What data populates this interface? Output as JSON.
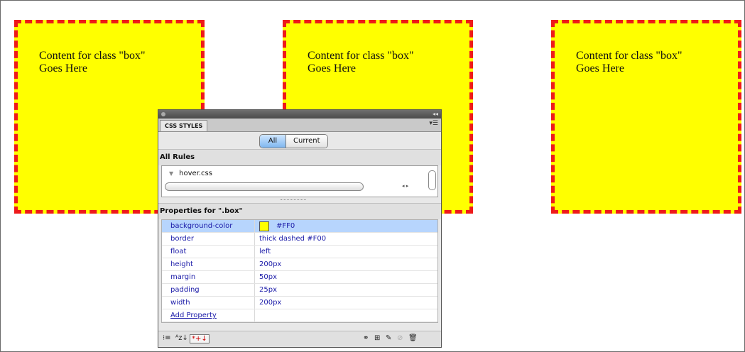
{
  "boxes": [
    {
      "line1": "Content for class \"box\"",
      "line2": "Goes Here"
    },
    {
      "line1": "Content for class \"box\"",
      "line2": "Goes Here"
    },
    {
      "line1": "Content for class \"box\"",
      "line2": "Goes Here"
    }
  ],
  "colors": {
    "box_bg": "#FFFF00",
    "box_border": "#FF0000",
    "selected_row": "#B7D5FD"
  },
  "panel": {
    "tab_label": "CSS STYLES",
    "segments": {
      "all": "All",
      "current": "Current",
      "selected": "All"
    },
    "all_rules_heading": "All Rules",
    "rules": [
      "hover.css"
    ],
    "properties_heading": "Properties for \".box\"",
    "properties": [
      {
        "name": "background-color",
        "value": "#FF0"
      },
      {
        "name": "border",
        "value": "thick dashed #F00"
      },
      {
        "name": "float",
        "value": "left"
      },
      {
        "name": "height",
        "value": "200px"
      },
      {
        "name": "margin",
        "value": "50px"
      },
      {
        "name": "padding",
        "value": "25px"
      },
      {
        "name": "width",
        "value": "200px"
      }
    ],
    "add_property": "Add Property",
    "toolbar_icons": [
      "category-view-icon",
      "alphabetical-view-icon",
      "set-properties-view-icon",
      "attach-stylesheet-icon",
      "new-rule-icon",
      "edit-rule-icon",
      "disable-property-icon",
      "delete-icon"
    ]
  }
}
